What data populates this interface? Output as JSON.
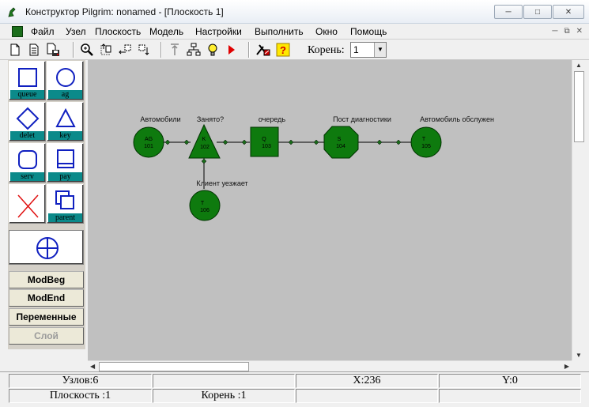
{
  "window": {
    "title": "Конструктор Pilgrim: nonamed - [Плоскость 1]"
  },
  "menu": {
    "items": [
      "Файл",
      "Узел",
      "Плоскость",
      "Модель",
      "Настройки",
      "Выполнить",
      "Окно",
      "Помощь"
    ]
  },
  "toolbar": {
    "root_label": "Корень:",
    "root_value": "1"
  },
  "palette": {
    "shapes": [
      {
        "label": "queue",
        "shape": "square-icon"
      },
      {
        "label": "ag",
        "shape": "circle-icon"
      },
      {
        "label": "delet",
        "shape": "diamond-icon"
      },
      {
        "label": "key",
        "shape": "triangle-icon"
      },
      {
        "label": "serv",
        "shape": "rounded-square-icon"
      },
      {
        "label": "pay",
        "shape": "pay-icon"
      },
      {
        "label": "",
        "shape": "delete-cross-icon"
      },
      {
        "label": "parent",
        "shape": "parent-icon"
      }
    ],
    "buttons": [
      "ModBeg",
      "ModEnd",
      "Переменные",
      "Слой"
    ]
  },
  "diagram": {
    "fill": "#0e7a0e",
    "nodes": [
      {
        "type": "AG",
        "id": "101",
        "caption": "Автомобили"
      },
      {
        "type": "K",
        "id": "102",
        "caption": "Занято?"
      },
      {
        "type": "Q",
        "id": "103",
        "caption": "очередь"
      },
      {
        "type": "S",
        "id": "104",
        "caption": "Пост диагностики"
      },
      {
        "type": "T",
        "id": "105",
        "caption": "Автомобиль обслужен"
      },
      {
        "type": "T",
        "id": "106",
        "caption": "Клиент уезжает"
      }
    ]
  },
  "status": {
    "nodes": "Узлов:6",
    "x": "X:236",
    "y": "Y:0",
    "plane": "Плоскость :1",
    "root": "Корень :1"
  }
}
